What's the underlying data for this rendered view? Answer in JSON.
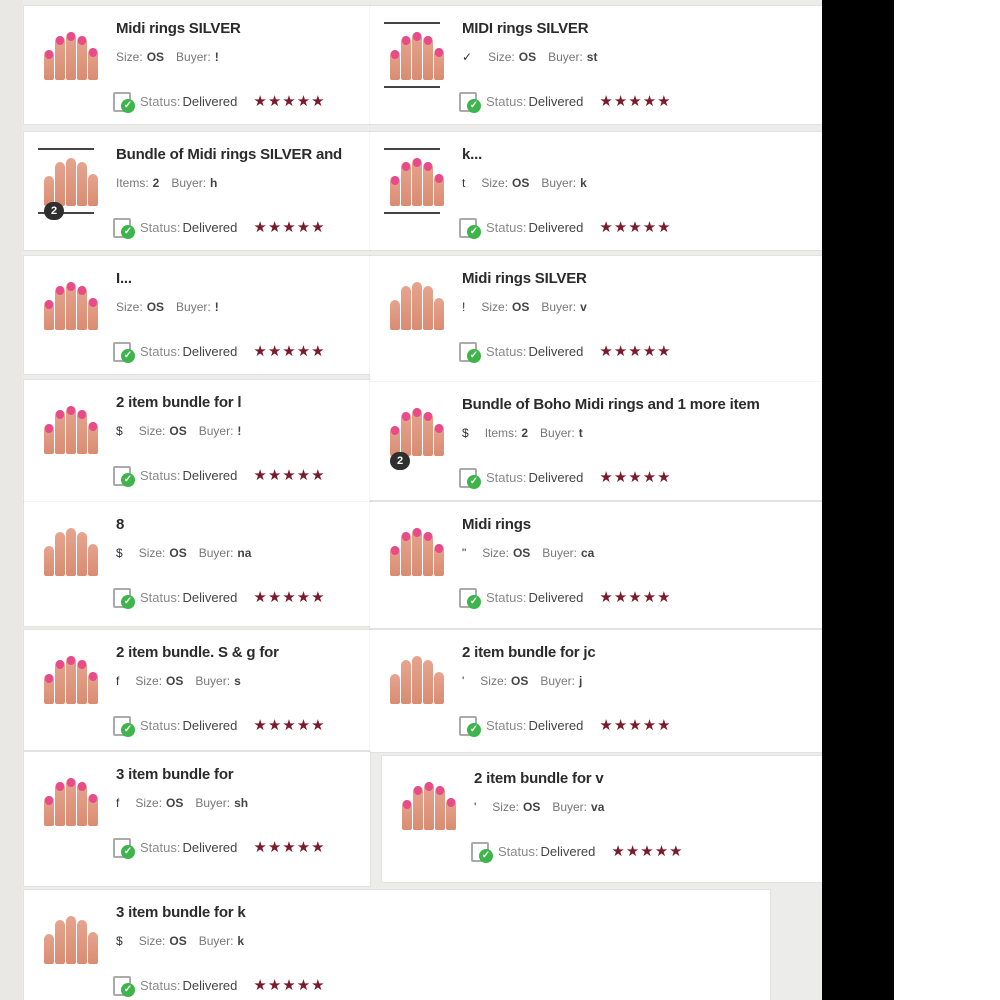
{
  "colors": {
    "star": "#7a1a2a",
    "check": "#3db54a",
    "nail_pink": "#e84a8a",
    "skin": "#e2a088"
  },
  "icons": {
    "status": "delivered-check-icon",
    "star": "star-icon",
    "thumb": "midi-rings-photo"
  },
  "status": {
    "label": "Status:",
    "value": "Delivered",
    "stars": "★★★★★"
  },
  "meta_labels": {
    "size": "Size:",
    "buyer": "Buyer:",
    "items": "Items:"
  },
  "sales": [
    {
      "title": "Midi rings SILVER",
      "pre": "",
      "size": "OS",
      "buyer": "!",
      "items": "",
      "badge": ""
    },
    {
      "title": "MIDI rings SILVER",
      "pre": "✓",
      "size": "OS",
      "buyer": "st",
      "items": "",
      "badge": ""
    },
    {
      "title": "Bundle of Midi rings SILVER and",
      "pre": "",
      "size": "",
      "buyer": "h",
      "items": "2",
      "badge": "2"
    },
    {
      "title": "k...",
      "pre": "t",
      "size": "OS",
      "buyer": "k",
      "items": "",
      "badge": ""
    },
    {
      "title": "I...",
      "pre": "",
      "size": "OS",
      "buyer": "!",
      "items": "",
      "badge": ""
    },
    {
      "title": "Midi rings SILVER",
      "pre": "!",
      "size": "OS",
      "buyer": "v",
      "items": "",
      "badge": ""
    },
    {
      "title": "2 item bundle for l",
      "pre": "$",
      "size": "OS",
      "buyer": "!",
      "items": "",
      "badge": ""
    },
    {
      "title": "Bundle of Boho Midi rings and 1 more item",
      "pre": "$",
      "size": "",
      "buyer": "t",
      "items": "2",
      "badge": "2"
    },
    {
      "title": "8",
      "pre": "$",
      "size": "OS",
      "buyer": "na",
      "items": "",
      "badge": ""
    },
    {
      "title": "Midi rings",
      "pre": "\"",
      "size": "OS",
      "buyer": "ca",
      "items": "",
      "badge": ""
    },
    {
      "title": "2 item bundle. S & g for",
      "pre": "f",
      "size": "OS",
      "buyer": "s",
      "items": "",
      "badge": ""
    },
    {
      "title": "2 item bundle for jc",
      "pre": "'",
      "size": "OS",
      "buyer": "j",
      "items": "",
      "badge": ""
    },
    {
      "title": "3 item bundle for",
      "pre": "f",
      "size": "OS",
      "buyer": "sh",
      "items": "",
      "badge": ""
    },
    {
      "title": "2 item bundle for v",
      "pre": "'",
      "size": "OS",
      "buyer": "va",
      "items": "",
      "badge": ""
    },
    {
      "title": "3 item bundle for k",
      "pre": "$",
      "size": "OS",
      "buyer": "k",
      "items": "",
      "badge": ""
    }
  ]
}
